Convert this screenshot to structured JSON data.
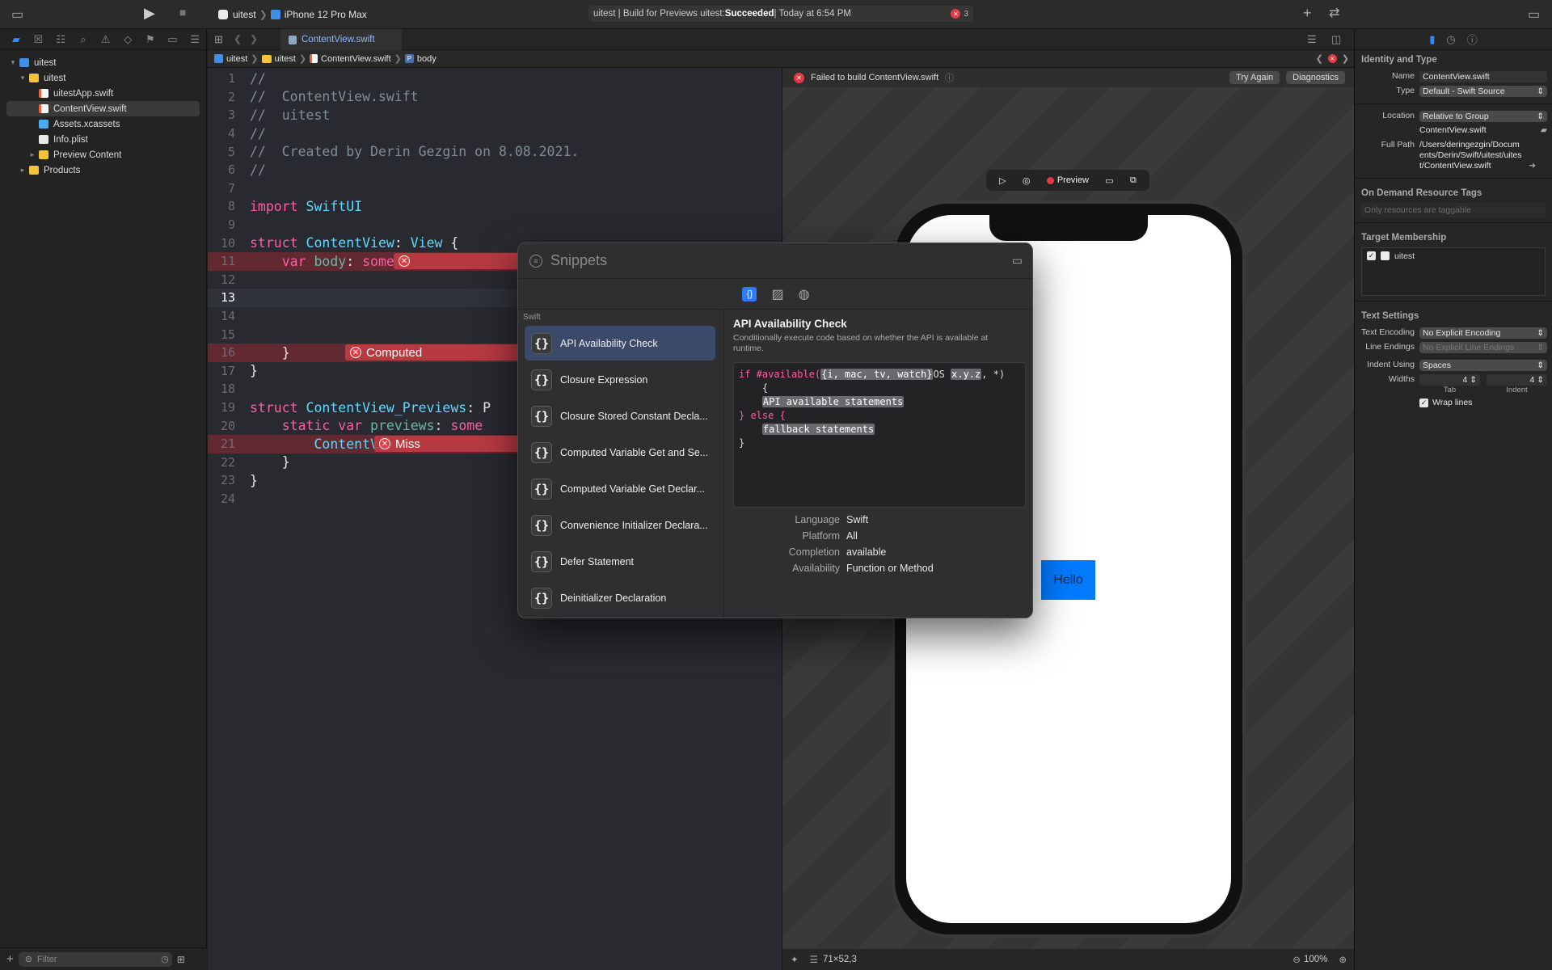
{
  "toolbar": {
    "scheme_project": "uitest",
    "scheme_device": "iPhone 12 Pro Max",
    "status_prefix": "uitest | Build for Previews uitest: ",
    "status_result": "Succeeded",
    "status_time": " | Today at 6:54 PM",
    "error_count": "3"
  },
  "navigator": {
    "tree": [
      {
        "label": "uitest",
        "icon": "project-icon",
        "indent": 0,
        "disclosure": "open"
      },
      {
        "label": "uitest",
        "icon": "folder-icon",
        "indent": 1,
        "disclosure": "open"
      },
      {
        "label": "uitestApp.swift",
        "icon": "swift-file-icon",
        "indent": 2,
        "disclosure": ""
      },
      {
        "label": "ContentView.swift",
        "icon": "swift-file-icon",
        "indent": 2,
        "disclosure": "",
        "selected": true
      },
      {
        "label": "Assets.xcassets",
        "icon": "asset-catalog-icon",
        "indent": 2,
        "disclosure": ""
      },
      {
        "label": "Info.plist",
        "icon": "plist-icon",
        "indent": 2,
        "disclosure": ""
      },
      {
        "label": "Preview Content",
        "icon": "folder-icon",
        "indent": 2,
        "disclosure": "closed"
      },
      {
        "label": "Products",
        "icon": "folder-icon",
        "indent": 1,
        "disclosure": "closed"
      }
    ],
    "filter_placeholder": "Filter"
  },
  "editor": {
    "tab_label": "ContentView.swift",
    "jumpbar": [
      "uitest",
      "uitest",
      "ContentView.swift",
      "body"
    ],
    "lines": [
      {
        "n": "1",
        "text": "//"
      },
      {
        "n": "2",
        "text": "//  ContentView.swift"
      },
      {
        "n": "3",
        "text": "//  uitest"
      },
      {
        "n": "4",
        "text": "//"
      },
      {
        "n": "5",
        "text": "//  Created by Derin Gezgin on 8.08.2021."
      },
      {
        "n": "6",
        "text": "//"
      },
      {
        "n": "7",
        "text": ""
      },
      {
        "n": "8",
        "text": "import SwiftUI"
      },
      {
        "n": "9",
        "text": ""
      },
      {
        "n": "10",
        "text": "struct ContentView: View {"
      },
      {
        "n": "11",
        "text": "    var body: some View {"
      },
      {
        "n": "12",
        "text": ""
      },
      {
        "n": "13",
        "text": ""
      },
      {
        "n": "14",
        "text": ""
      },
      {
        "n": "15",
        "text": ""
      },
      {
        "n": "16",
        "text": "    }"
      },
      {
        "n": "17",
        "text": "}"
      },
      {
        "n": "18",
        "text": ""
      },
      {
        "n": "19",
        "text": "struct ContentView_Previews: P"
      },
      {
        "n": "20",
        "text": "    static var previews: some"
      },
      {
        "n": "21",
        "text": "        ContentView()"
      },
      {
        "n": "22",
        "text": "    }"
      },
      {
        "n": "23",
        "text": "}"
      },
      {
        "n": "24",
        "text": ""
      }
    ],
    "error_pills": [
      {
        "line": "11",
        "text": ""
      },
      {
        "line": "16",
        "text": "Computed"
      },
      {
        "line": "21",
        "text": "Miss"
      }
    ]
  },
  "canvas": {
    "error_message": "Failed to build ContentView.swift",
    "try_again": "Try Again",
    "diagnostics": "Diagnostics",
    "preview_label": "Preview",
    "hello": "Hello",
    "size_readout": "71×52,3",
    "zoom": "100%"
  },
  "snippets": {
    "search_placeholder": "Snippets",
    "group_label": "Swift",
    "items": [
      "API Availability Check",
      "Closure Expression",
      "Closure Stored Constant Decla...",
      "Computed Variable Get and Se...",
      "Computed Variable Get Declar...",
      "Convenience Initializer Declara...",
      "Defer Statement",
      "Deinitializer Declaration"
    ],
    "selected_title": "API Availability Check",
    "selected_description": "Conditionally execute code based on whether the API is available at runtime.",
    "code": {
      "l1_pre": "if #available(",
      "l1_ph1": "{i, mac, tv, watch}",
      "l1_mid": "OS ",
      "l1_ph2": "x.y.z",
      "l1_post": ", *)",
      "l2": "    {",
      "l3_ph": "API available statements",
      "l4": "} else {",
      "l5_ph": "fallback statements",
      "l6": "}"
    },
    "meta": [
      {
        "k": "Language",
        "v": "Swift"
      },
      {
        "k": "Platform",
        "v": "All"
      },
      {
        "k": "Completion",
        "v": "available"
      },
      {
        "k": "Availability",
        "v": "Function or Method"
      }
    ]
  },
  "inspector": {
    "identity_title": "Identity and Type",
    "name_label": "Name",
    "name_value": "ContentView.swift",
    "type_label": "Type",
    "type_value": "Default - Swift Source",
    "location_label": "Location",
    "location_value": "Relative to Group",
    "location_file": "ContentView.swift",
    "full_path_label": "Full Path",
    "full_path_value": "/Users/deringezgin/Documents/Derin/Swift/uitest/uitest/ContentView.swift",
    "odr_title": "On Demand Resource Tags",
    "odr_placeholder": "Only resources are taggable",
    "target_title": "Target Membership",
    "target_name": "uitest",
    "text_title": "Text Settings",
    "encoding_label": "Text Encoding",
    "encoding_value": "No Explicit Encoding",
    "line_endings_label": "Line Endings",
    "line_endings_value": "No Explicit Line Endings",
    "indent_label": "Indent Using",
    "indent_value": "Spaces",
    "widths_label": "Widths",
    "tab_value": "4",
    "indent_value_num": "4",
    "tab_caption": "Tab",
    "indent_caption": "Indent",
    "wrap_label": "Wrap lines"
  },
  "colors": {
    "accent": "#2f7bf5",
    "error": "#e13b45",
    "hello_button": "#007aff"
  }
}
